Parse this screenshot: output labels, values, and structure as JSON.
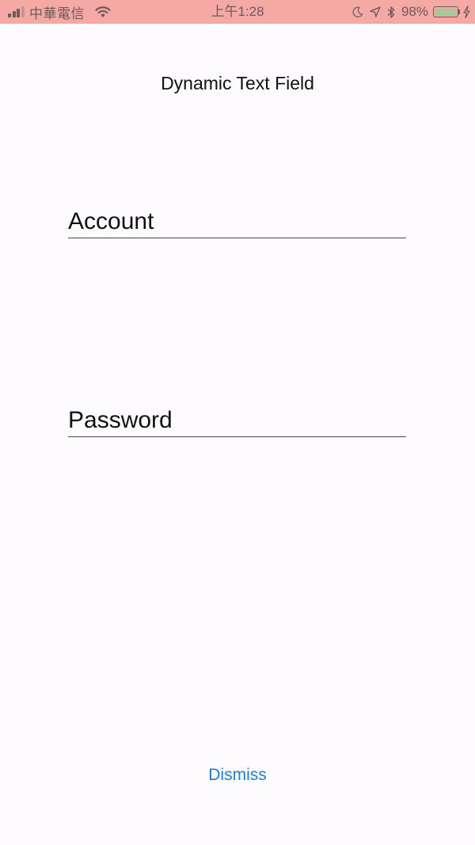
{
  "status_bar": {
    "carrier": "中華電信",
    "time": "上午1:28",
    "battery_percent": "98%",
    "battery_level": 0.98,
    "icons": [
      "signal-icon",
      "wifi-icon",
      "moon-icon",
      "location-arrow-icon",
      "bluetooth-icon",
      "battery-icon",
      "charging-bolt-icon"
    ],
    "background_color": "#f4a9a5"
  },
  "header": {
    "title": "Dynamic Text Field"
  },
  "form": {
    "account_placeholder": "Account",
    "password_placeholder": "Password"
  },
  "footer": {
    "dismiss_label": "Dismiss",
    "accent_color": "#1a7ee0"
  }
}
